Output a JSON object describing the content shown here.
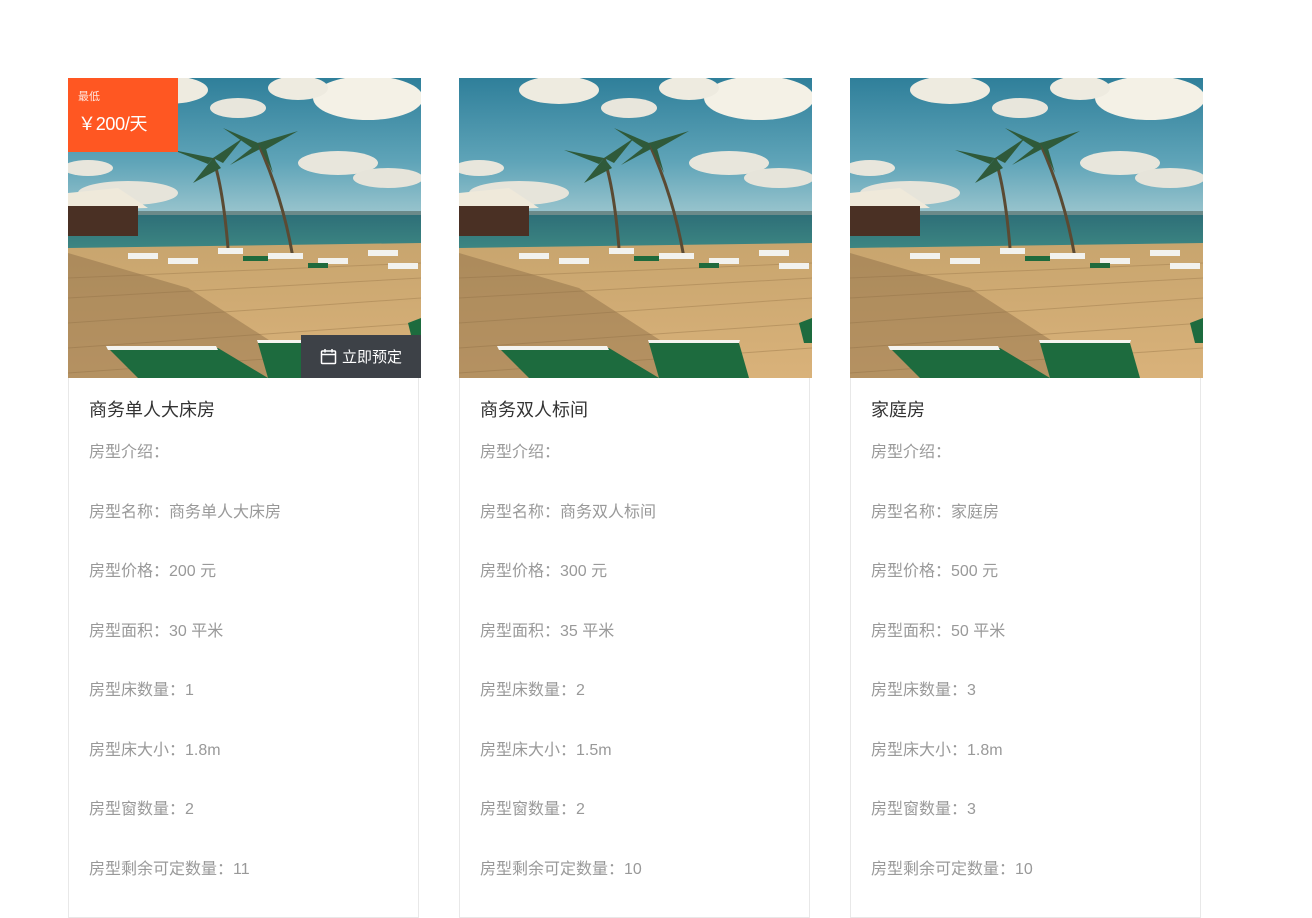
{
  "rooms": [
    {
      "price_tag": {
        "label": "最低",
        "value": "￥200/天"
      },
      "book_label": "立即预定",
      "title": "商务单人大床房",
      "rows": [
        "房型介绍：",
        "房型名称：商务单人大床房",
        "房型价格：200 元",
        "房型面积：30 平米",
        "房型床数量：1",
        "房型床大小：1.8m",
        "房型窗数量：2",
        "房型剩余可定数量：11"
      ]
    },
    {
      "title": "商务双人标间",
      "rows": [
        "房型介绍：",
        "房型名称：商务双人标间",
        "房型价格：300 元",
        "房型面积：35 平米",
        "房型床数量：2",
        "房型床大小：1.5m",
        "房型窗数量：2",
        "房型剩余可定数量：10"
      ]
    },
    {
      "title": "家庭房",
      "rows": [
        "房型介绍：",
        "房型名称：家庭房",
        "房型价格：500 元",
        "房型面积：50 平米",
        "房型床数量：3",
        "房型床大小：1.8m",
        "房型窗数量：3",
        "房型剩余可定数量：10"
      ]
    }
  ],
  "colors": {
    "price_tag_bg": "#ff5722",
    "book_button_bg": "#3d4147"
  },
  "icons": {
    "book_button": "calendar-icon"
  }
}
